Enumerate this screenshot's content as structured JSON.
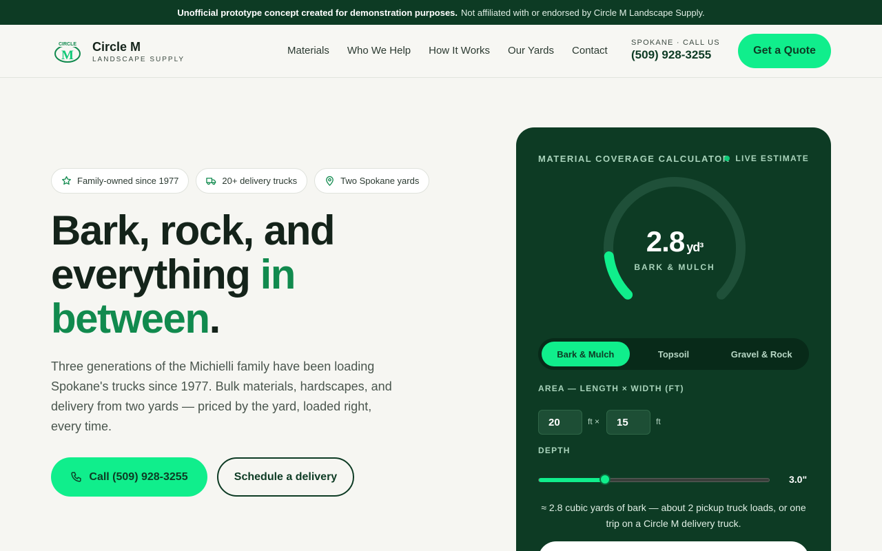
{
  "banner": {
    "bold": "Unofficial prototype concept created for demonstration purposes.",
    "text": "Not affiliated with or endorsed by Circle M Landscape Supply."
  },
  "header": {
    "logo_icon": "circle-m-logo",
    "logo_mark_text": "CIRCLE",
    "logo_mark_letter": "M",
    "logo_name": "Circle M",
    "logo_sub": "LANDSCAPE SUPPLY",
    "nav": [
      "Materials",
      "Who We Help",
      "How It Works",
      "Our Yards",
      "Contact"
    ],
    "phone_label": "SPOKANE · CALL US",
    "phone": "(509) 928-3255",
    "quote_button": "Get a Quote"
  },
  "hero": {
    "badges": [
      {
        "icon": "star-icon",
        "label": "Family-owned since 1977"
      },
      {
        "icon": "truck-icon",
        "label": "20+ delivery trucks"
      },
      {
        "icon": "map-pin-icon",
        "label": "Two Spokane yards"
      }
    ],
    "title_line1": "Bark, rock, and",
    "title_line2": "everything ",
    "title_accent1": "in",
    "title_accent2": "between",
    "title_period": ".",
    "description": "Three generations of the Michielli family have been loading Spokane's trucks since 1977. Bulk materials, hardscapes, and delivery from two yards — priced by the yard, loaded right, every time.",
    "cta_call": "Call (509) 928-3255",
    "cta_call_icon": "phone-icon",
    "cta_schedule": "Schedule a delivery"
  },
  "calculator": {
    "title": "MATERIAL COVERAGE CALCULATOR",
    "live_label": "LIVE ESTIMATE",
    "gauge_value": "2.8",
    "gauge_unit": "yd³",
    "gauge_label": "BARK & MULCH",
    "gauge_fill_fraction": 0.14,
    "tabs": [
      "Bark & Mulch",
      "Topsoil",
      "Gravel & Rock"
    ],
    "active_tab": 0,
    "area_label": "AREA — LENGTH × WIDTH (FT)",
    "length": "20",
    "length_unit": "ft ×",
    "width": "15",
    "width_unit": "ft",
    "depth_label": "DEPTH",
    "depth_value": "3.0\"",
    "depth_fraction": 0.29,
    "note": "≈ 2.8 cubic yards of bark — about 2 pickup truck loads, or one trip on a Circle M delivery truck.",
    "colors": {
      "panel": "#0d3b24",
      "accent": "#10ee8c",
      "track": "#1f5039"
    }
  }
}
